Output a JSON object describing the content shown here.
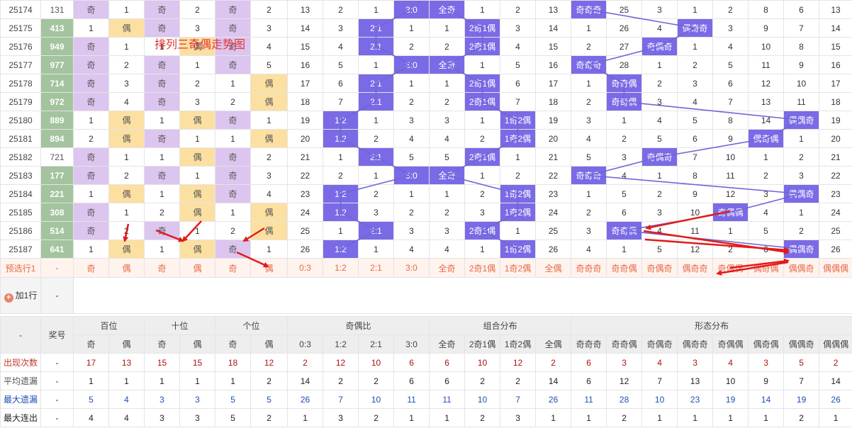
{
  "title": "排列三奇偶走势图",
  "rows": [
    {
      "period": "25174",
      "number": "131",
      "bw": [
        "奇",
        "1"
      ],
      "sw": [
        "奇",
        "2"
      ],
      "gw": [
        "奇",
        "2"
      ],
      "ratio": [
        "13",
        "2",
        "1",
        "3:0"
      ],
      "combo": [
        "全奇",
        "1",
        "2",
        "13"
      ],
      "form": [
        "奇奇奇",
        "25",
        "3",
        "1",
        "2",
        "8",
        "6",
        "13"
      ]
    },
    {
      "period": "25175",
      "number": "413",
      "bw": [
        "1",
        "偶"
      ],
      "sw": [
        "奇",
        "3"
      ],
      "gw": [
        "奇",
        "3"
      ],
      "ratio": [
        "14",
        "3",
        "2:1",
        "1"
      ],
      "combo": [
        "1",
        "2奇1偶",
        "3",
        "14"
      ],
      "form": [
        "1",
        "26",
        "4",
        "偶奇奇",
        "3",
        "9",
        "7",
        "14"
      ]
    },
    {
      "period": "25176",
      "number": "949",
      "bw": [
        "奇",
        "1"
      ],
      "sw": [
        "1",
        "偶"
      ],
      "gw": [
        "奇",
        "4"
      ],
      "ratio": [
        "15",
        "4",
        "2:1",
        "2"
      ],
      "combo": [
        "2",
        "2奇1偶",
        "4",
        "15"
      ],
      "form": [
        "2",
        "27",
        "奇偶奇",
        "1",
        "4",
        "10",
        "8",
        "15"
      ]
    },
    {
      "period": "25177",
      "number": "977",
      "bw": [
        "奇",
        "2"
      ],
      "sw": [
        "奇",
        "1"
      ],
      "gw": [
        "奇",
        "5"
      ],
      "ratio": [
        "16",
        "5",
        "1",
        "3:0"
      ],
      "combo": [
        "全奇",
        "1",
        "5",
        "16"
      ],
      "form": [
        "奇奇奇",
        "28",
        "1",
        "2",
        "5",
        "11",
        "9",
        "16"
      ]
    },
    {
      "period": "25178",
      "number": "714",
      "bw": [
        "奇",
        "3"
      ],
      "sw": [
        "奇",
        "2"
      ],
      "gw": [
        "1",
        "偶"
      ],
      "ratio": [
        "17",
        "6",
        "2:1",
        "1"
      ],
      "combo": [
        "1",
        "2奇1偶",
        "6",
        "17"
      ],
      "form": [
        "1",
        "奇奇偶",
        "2",
        "3",
        "6",
        "12",
        "10",
        "17"
      ]
    },
    {
      "period": "25179",
      "number": "972",
      "bw": [
        "奇",
        "4"
      ],
      "sw": [
        "奇",
        "3"
      ],
      "gw": [
        "2",
        "偶"
      ],
      "ratio": [
        "18",
        "7",
        "2:1",
        "2"
      ],
      "combo": [
        "2",
        "2奇1偶",
        "7",
        "18"
      ],
      "form": [
        "2",
        "奇奇偶",
        "3",
        "4",
        "7",
        "13",
        "11",
        "18"
      ]
    },
    {
      "period": "25180",
      "number": "889",
      "bw": [
        "1",
        "偶"
      ],
      "sw": [
        "1",
        "偶"
      ],
      "gw": [
        "奇",
        "1"
      ],
      "ratio": [
        "19",
        "1:2",
        "1",
        "3"
      ],
      "combo": [
        "3",
        "1",
        "1奇2偶",
        "19"
      ],
      "form": [
        "3",
        "1",
        "4",
        "5",
        "8",
        "14",
        "偶偶奇",
        "19"
      ]
    },
    {
      "period": "25181",
      "number": "894",
      "bw": [
        "2",
        "偶"
      ],
      "sw": [
        "奇",
        "1"
      ],
      "gw": [
        "1",
        "偶"
      ],
      "ratio": [
        "20",
        "1:2",
        "2",
        "4"
      ],
      "combo": [
        "4",
        "2",
        "1奇2偶",
        "20"
      ],
      "form": [
        "4",
        "2",
        "5",
        "6",
        "9",
        "偶奇偶",
        "1",
        "20"
      ]
    },
    {
      "period": "25182",
      "number": "721",
      "bw": [
        "奇",
        "1"
      ],
      "sw": [
        "1",
        "偶"
      ],
      "gw": [
        "奇",
        "2"
      ],
      "ratio": [
        "21",
        "1",
        "2:1",
        "5"
      ],
      "combo": [
        "5",
        "2奇1偶",
        "1",
        "21"
      ],
      "form": [
        "5",
        "3",
        "奇偶奇",
        "7",
        "10",
        "1",
        "2",
        "21"
      ]
    },
    {
      "period": "25183",
      "number": "177",
      "bw": [
        "奇",
        "2"
      ],
      "sw": [
        "奇",
        "1"
      ],
      "gw": [
        "奇",
        "3"
      ],
      "ratio": [
        "22",
        "2",
        "1",
        "3:0"
      ],
      "combo": [
        "全奇",
        "1",
        "2",
        "22"
      ],
      "form": [
        "奇奇奇",
        "4",
        "1",
        "8",
        "11",
        "2",
        "3",
        "22"
      ]
    },
    {
      "period": "25184",
      "number": "221",
      "bw": [
        "1",
        "偶"
      ],
      "sw": [
        "1",
        "偶"
      ],
      "gw": [
        "奇",
        "4"
      ],
      "ratio": [
        "23",
        "1:2",
        "2",
        "1"
      ],
      "combo": [
        "1",
        "2",
        "1奇2偶",
        "23"
      ],
      "form": [
        "1",
        "5",
        "2",
        "9",
        "12",
        "3",
        "偶偶奇",
        "23"
      ]
    },
    {
      "period": "25185",
      "number": "308",
      "bw": [
        "奇",
        "1"
      ],
      "sw": [
        "2",
        "偶"
      ],
      "gw": [
        "1",
        "偶"
      ],
      "ratio": [
        "24",
        "1:2",
        "3",
        "2"
      ],
      "combo": [
        "2",
        "3",
        "1奇2偶",
        "24"
      ],
      "form": [
        "2",
        "6",
        "3",
        "10",
        "奇偶偶",
        "4",
        "1",
        "24"
      ]
    },
    {
      "period": "25186",
      "number": "514",
      "bw": [
        "奇",
        "2"
      ],
      "sw": [
        "奇",
        "1"
      ],
      "gw": [
        "2",
        "偶"
      ],
      "ratio": [
        "25",
        "1",
        "2:1",
        "3"
      ],
      "combo": [
        "3",
        "2奇1偶",
        "1",
        "25"
      ],
      "form": [
        "3",
        "奇奇偶",
        "4",
        "11",
        "1",
        "5",
        "2",
        "25"
      ]
    },
    {
      "period": "25187",
      "number": "641",
      "bw": [
        "1",
        "偶"
      ],
      "sw": [
        "1",
        "偶"
      ],
      "gw": [
        "奇",
        "1"
      ],
      "ratio": [
        "26",
        "1:2",
        "1",
        "4"
      ],
      "combo": [
        "4",
        "1",
        "1奇2偶",
        "26"
      ],
      "form": [
        "4",
        "1",
        "5",
        "12",
        "2",
        "6",
        "偶偶奇",
        "26"
      ]
    }
  ],
  "predict": {
    "label": "预选行1",
    "dash": "-",
    "cells": [
      "奇",
      "偶",
      "奇",
      "偶",
      "奇",
      "偶",
      "0:3",
      "1:2",
      "2:1",
      "3:0",
      "全奇",
      "2奇1偶",
      "1奇2偶",
      "全偶",
      "奇奇奇",
      "奇奇偶",
      "奇偶奇",
      "偶奇奇",
      "奇偶偶",
      "偶奇偶",
      "偶偶奇",
      "偶偶偶"
    ]
  },
  "add_row": {
    "label": "加1行",
    "dash": "-"
  },
  "header": {
    "dash": "-",
    "draw_label": "奖号",
    "groups": [
      "百位",
      "十位",
      "个位",
      "奇偶比",
      "组合分布",
      "形态分布"
    ],
    "sub": [
      "奇",
      "偶",
      "奇",
      "偶",
      "奇",
      "偶",
      "0:3",
      "1:2",
      "2:1",
      "3:0",
      "全奇",
      "2奇1偶",
      "1奇2偶",
      "全偶",
      "奇奇奇",
      "奇奇偶",
      "奇偶奇",
      "偶奇奇",
      "奇偶偶",
      "偶奇偶",
      "偶偶奇",
      "偶偶偶"
    ]
  },
  "stats": [
    {
      "label": "出现次数",
      "dash": "-",
      "values": [
        "17",
        "13",
        "15",
        "15",
        "18",
        "12",
        "2",
        "12",
        "10",
        "6",
        "6",
        "10",
        "12",
        "2",
        "6",
        "3",
        "4",
        "3",
        "4",
        "3",
        "5",
        "2"
      ]
    },
    {
      "label": "平均遗漏",
      "dash": "-",
      "values": [
        "1",
        "1",
        "1",
        "1",
        "1",
        "2",
        "14",
        "2",
        "2",
        "6",
        "6",
        "2",
        "2",
        "14",
        "6",
        "12",
        "7",
        "13",
        "10",
        "9",
        "7",
        "14"
      ]
    },
    {
      "label": "最大遗漏",
      "dash": "-",
      "values": [
        "5",
        "4",
        "3",
        "3",
        "5",
        "5",
        "26",
        "7",
        "10",
        "11",
        "11",
        "10",
        "7",
        "26",
        "11",
        "28",
        "10",
        "23",
        "19",
        "14",
        "19",
        "26"
      ]
    },
    {
      "label": "最大连出",
      "dash": "-",
      "values": [
        "4",
        "4",
        "3",
        "3",
        "5",
        "2",
        "1",
        "3",
        "2",
        "1",
        "1",
        "2",
        "3",
        "1",
        "1",
        "2",
        "1",
        "1",
        "1",
        "1",
        "2",
        "1"
      ]
    }
  ],
  "colors": {
    "ball": "#7a6ae6",
    "odd": "#dcc5ef",
    "even": "#fce0a2",
    "number": "#a4c39f",
    "line": "#6e66d6",
    "arrow": "#e21b1b"
  }
}
